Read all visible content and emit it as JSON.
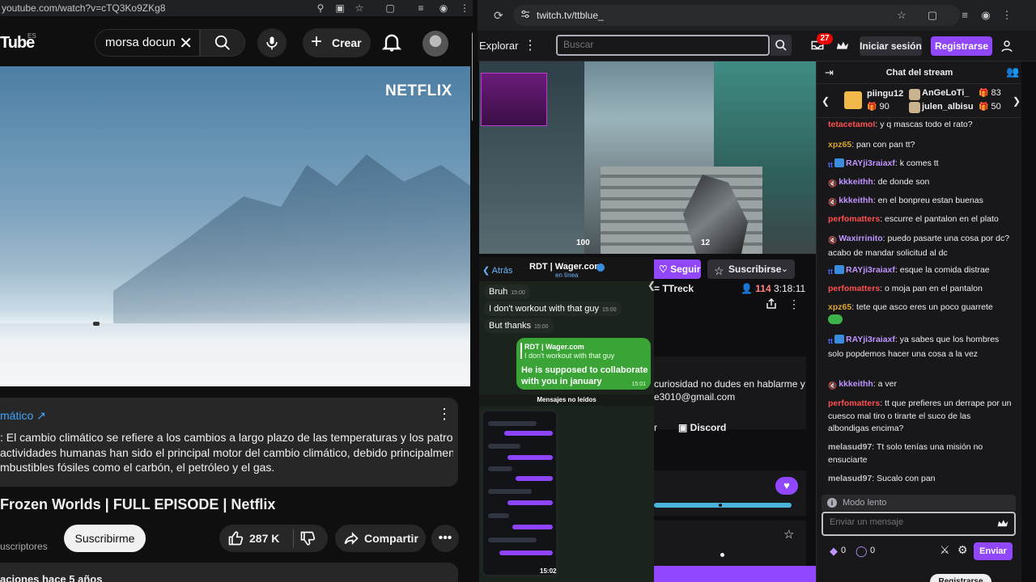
{
  "youtube": {
    "address_url": "youtube.com/watch?v=cTQ3Ko9ZKg8",
    "logo_text": "Tube",
    "logo_region": "ES",
    "search_value": "morsa docun",
    "create_label": "Crear",
    "video_watermark": "NETFLIX",
    "info_link": "mático",
    "info_desc": "El cambio climático se refiere a los cambios a largo plazo de las temperaturas y los patrones actividades humanas han sido el principal motor del cambio climático, debido principalmente a mbustibles fósiles como el carbón, el petróleo y el gas.",
    "info_desc_lines": [
      ": El cambio climático se refiere a los cambios a largo plazo de las temperaturas y los patrones",
      "actividades humanas han sido el principal motor del cambio climático, debido principalmente a",
      "mbustibles fósiles como el carbón, el petróleo y el gas."
    ],
    "video_title": "Frozen Worlds | FULL EPISODE | Netflix",
    "subscribers_label": "uscriptores",
    "subscribe_label": "Suscribirme",
    "like_count": "287 K",
    "share_label": "Compartir",
    "meta_line": "aciones  hace 5 años"
  },
  "twitch": {
    "address_url": "twitch.tv/ttblue_",
    "explore_label": "Explorar",
    "search_placeholder": "Buscar",
    "notification_count": "27",
    "login_label": "Iniciar sesión",
    "register_label": "Registrarse",
    "player": {
      "hud_health": "100",
      "hud_ammo": "12"
    },
    "follow_label": "Seguir",
    "subscribe_label": "Suscribirse",
    "streamer_name": "= TTreck",
    "viewer_count": "114",
    "uptime": "3:18:11",
    "about_line1": "curiosidad no dudes en hablarme y",
    "about_line2": "e3010@gmail.com",
    "social_r": "r",
    "discord_label": "Discord",
    "chat": {
      "title": "Chat del stream",
      "gifters": [
        {
          "name": "piingu12",
          "count": "90"
        },
        {
          "name": "AnGeLoTi_",
          "count": "83"
        },
        {
          "name": "julen_albisu",
          "count": "50"
        }
      ],
      "messages": [
        {
          "user": "tetacetamol",
          "color": "#ff4f4f",
          "badge": "",
          "text": ": y q mascas todo el rato?"
        },
        {
          "user": "xpz65",
          "color": "#daa520",
          "badge": "",
          "text": ": pan con pan tt?"
        },
        {
          "user": "RAYji3raiaxf",
          "color": "#bf94ff",
          "badge": "tt",
          "text": ": k comes tt"
        },
        {
          "user": "kkkeithh",
          "color": "#bf94ff",
          "badge": "mute",
          "text": ": de donde son"
        },
        {
          "user": "kkkeithh",
          "color": "#bf94ff",
          "badge": "mute",
          "text": ": en el bonpreu estan buenas"
        },
        {
          "user": "perfomatters",
          "color": "#ff4f4f",
          "badge": "",
          "text": ": escurre el pantalon en el plato"
        },
        {
          "user": "Waxirrinito",
          "color": "#bf94ff",
          "badge": "mute",
          "text": ": puedo pasarte una cosa por dc? acabo de mandar solicitud al dc"
        },
        {
          "user": "RAYji3raiaxf",
          "color": "#bf94ff",
          "badge": "tt",
          "text": ": esque la comida distrae"
        },
        {
          "user": "perfomatters",
          "color": "#ff4f4f",
          "badge": "",
          "text": ": o moja pan en el pantalon"
        },
        {
          "user": "xpz65",
          "color": "#daa520",
          "badge": "",
          "text": ": tete que asco eres un poco guarrete"
        },
        {
          "user": "RAYji3raiaxf",
          "color": "#bf94ff",
          "badge": "tt",
          "text": ": ya sabes que los hombres solo popdemos hacer una cosa a la vez"
        },
        {
          "user": "kkkeithh",
          "color": "#bf94ff",
          "badge": "mute",
          "text": ": a ver"
        },
        {
          "user": "perfomatters",
          "color": "#ff4f4f",
          "badge": "",
          "text": ": tt que prefieres un derrape por un cuesco mal tiro o tirarte el suco de las albondigas encima?"
        },
        {
          "user": "melasud97",
          "color": "#c0c0c0",
          "badge": "",
          "text": ": Tt solo tenías una misión no ensuciarte"
        },
        {
          "user": "melasud97",
          "color": "#c0c0c0",
          "badge": "",
          "text": ": Sucalo con pan"
        }
      ],
      "slow_mode_label": "Modo lento",
      "input_placeholder": "Enviar un mensaje",
      "bits": "0",
      "points": "0",
      "send_label": "Enviar",
      "bottom_register": "Registrarse"
    }
  },
  "telegram": {
    "back_label": "Atrás",
    "contact_name": "RDT | Wager.com",
    "status": "en línea",
    "messages": [
      {
        "text": "Bruh",
        "time": "15:00"
      },
      {
        "text": "I don't workout with that guy",
        "time": "15:00"
      },
      {
        "text": "But thanks",
        "time": "15:00"
      }
    ],
    "reply_quote_name": "RDT | Wager.com",
    "reply_quote_text": "I don't workout with that guy",
    "reply_text_1": "He is supposed to collaborate",
    "reply_text_2": "with you in january",
    "reply_time": "15:01",
    "unread_label": "Mensajes no leídos",
    "phone_time": "15:02"
  },
  "colors": {
    "twitch_purple": "#9147ff",
    "yt_link": "#3ea6ff",
    "telegram_green": "#3aa436"
  }
}
